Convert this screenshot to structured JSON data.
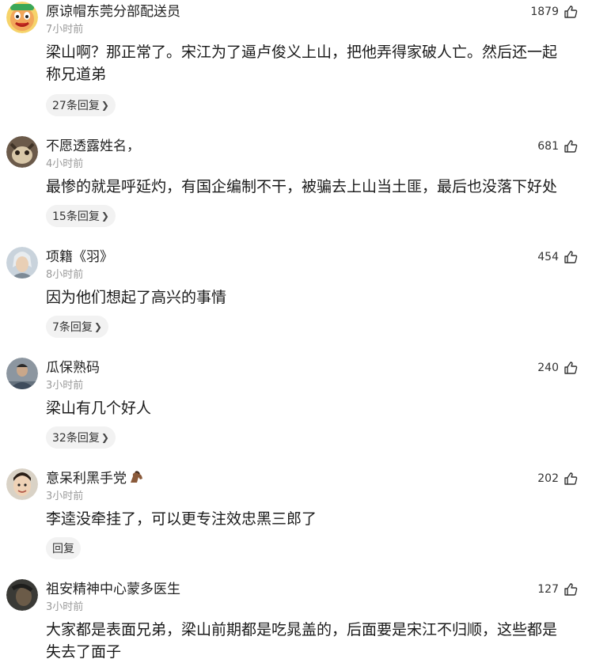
{
  "comments": [
    {
      "username": "原谅帽东莞分部配送员",
      "time": "7小时前",
      "likes": "1879",
      "content_lines": [
        "梁山啊？那正常了。宋江为了逼卢俊义上山，把他弄得家破人亡。然后还一起",
        "称兄道弟"
      ],
      "reply_label": "27条回复",
      "avatar_icon": "cartoon-face-avatar"
    },
    {
      "username": "不愿透露姓名，",
      "time": "4小时前",
      "likes": "681",
      "content_lines": [
        "最惨的就是呼延灼，有国企编制不干，被骗去上山当土匪，最后也没落下好处"
      ],
      "reply_label": "15条回复",
      "avatar_icon": "animal-photo-avatar"
    },
    {
      "username": "项籍《羽》",
      "time": "8小时前",
      "likes": "454",
      "content_lines": [
        "因为他们想起了高兴的事情"
      ],
      "reply_label": "7条回复",
      "avatar_icon": "character-portrait-avatar"
    },
    {
      "username": "瓜保熟码",
      "time": "3小时前",
      "likes": "240",
      "content_lines": [
        "梁山有几个好人"
      ],
      "reply_label": "32条回复",
      "avatar_icon": "person-photo-avatar"
    },
    {
      "username": "意呆利黑手党",
      "time": "3小时前",
      "likes": "202",
      "content_lines": [
        "李逵没牵挂了，可以更专注效忠黑三郎了"
      ],
      "reply_label": "回复",
      "avatar_icon": "child-photo-avatar",
      "name_emoji": "horse-emoji-icon"
    },
    {
      "username": "祖安精神中心蒙多医生",
      "time": "3小时前",
      "likes": "127",
      "content_lines": [
        "大家都是表面兄弟，梁山前期都是吃晁盖的，后面要是宋江不归顺，这些都是",
        "失去了面子"
      ],
      "reply_label": "",
      "avatar_icon": "dark-photo-avatar"
    }
  ]
}
